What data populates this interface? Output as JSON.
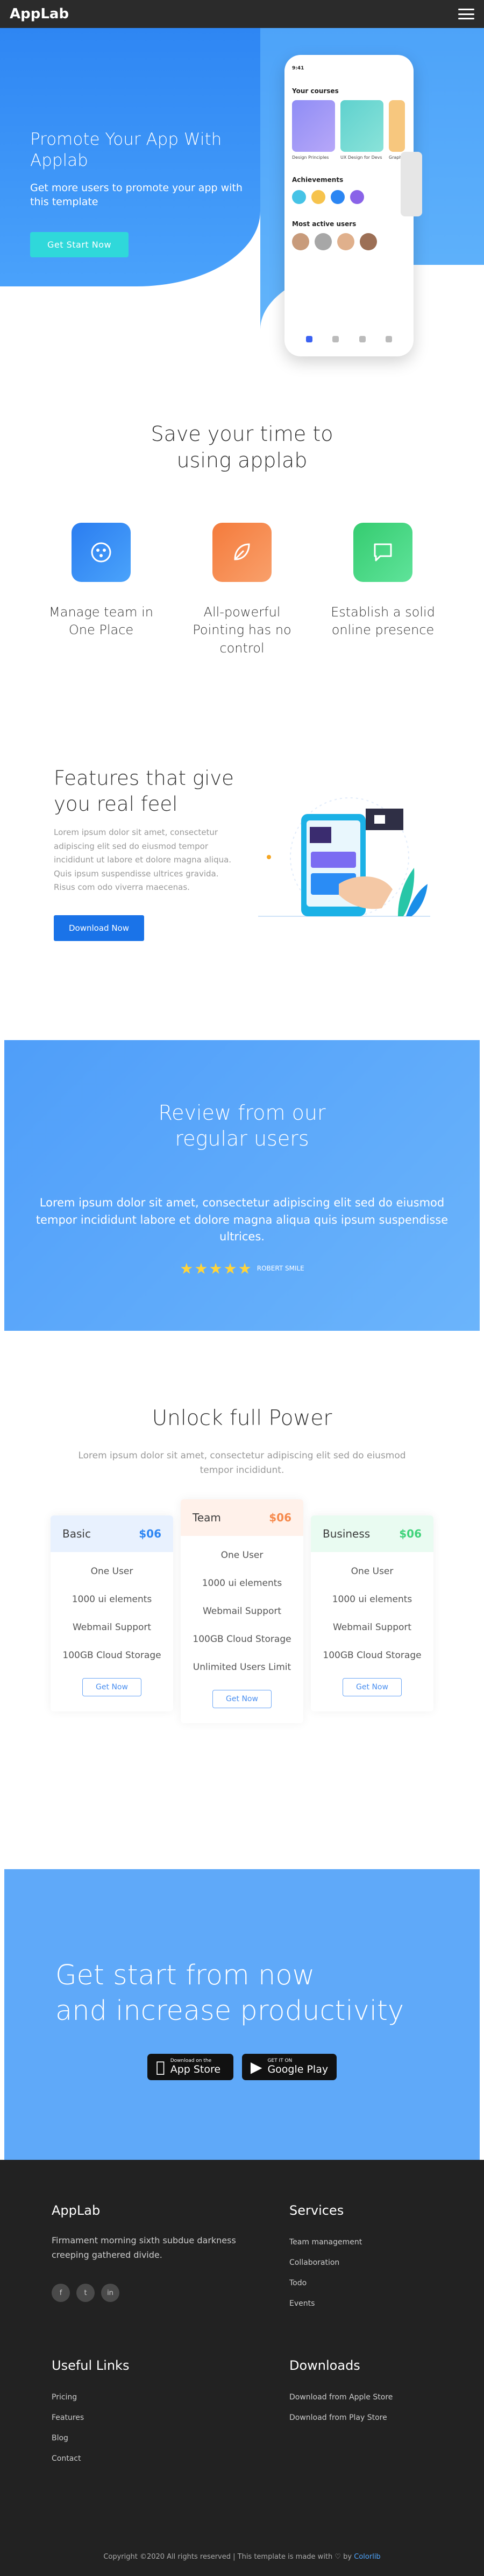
{
  "header": {
    "brand": "AppLab"
  },
  "hero": {
    "title": "Promote Your App With Applab",
    "subtitle": "Get more users to promote your app with this template",
    "button": "Get Start Now"
  },
  "phone": {
    "time": "9:41",
    "courses_title": "Your courses",
    "courses": [
      {
        "label": "Design Principles"
      },
      {
        "label": "UX Design for Devs"
      },
      {
        "label": "Graphic"
      }
    ],
    "achievements_title": "Achievements",
    "active_title": "Most active users"
  },
  "save": {
    "title_line1": "Save your time to",
    "title_line2": "using applab",
    "cards": [
      {
        "label": "Manage team in One Place",
        "icon": "team-icon",
        "color": "#2e86f3"
      },
      {
        "label": "All-powerful Pointing has no control",
        "icon": "leaf-icon",
        "color": "#f68a4d"
      },
      {
        "label": "Establish a solid online presence",
        "icon": "chat-icon",
        "color": "#3fd37a"
      }
    ]
  },
  "features": {
    "title": "Features that give you real feel",
    "text": "Lorem ipsum dolor sit amet, consectetur adipiscing elit sed do eiusmod tempor incididunt ut labore et dolore magna aliqua. Quis ipsum suspendisse ultrices gravida. Risus com odo viverra maecenas.",
    "button": "Download Now"
  },
  "review": {
    "title_line1": "Review from our",
    "title_line2": "regular users",
    "text": "Lorem ipsum dolor sit amet, consectetur adipiscing elit sed do eiusmod tempor incididunt labore et dolore magna aliqua quis ipsum suspendisse ultrices.",
    "stars": "★★★★★",
    "name": "ROBERT SMILE"
  },
  "pricing": {
    "title": "Unlock full Power",
    "subtitle": "Lorem ipsum dolor sit amet, consectetur adipiscing elit sed do eiusmod tempor incididunt.",
    "plans": [
      {
        "name": "Basic",
        "price": "$06",
        "features": [
          "One User",
          "1000 ui elements",
          "Webmail Support",
          "100GB Cloud Storage"
        ],
        "button": "Get Now",
        "head_bg": "#e8f1fe",
        "price_color": "#2e86f3"
      },
      {
        "name": "Team",
        "price": "$06",
        "features": [
          "One User",
          "1000 ui elements",
          "Webmail Support",
          "100GB Cloud Storage",
          "Unlimited Users Limit"
        ],
        "button": "Get Now",
        "head_bg": "#fff1ea",
        "price_color": "#f68a4d"
      },
      {
        "name": "Business",
        "price": "$06",
        "features": [
          "One User",
          "1000 ui elements",
          "Webmail Support",
          "100GB Cloud Storage"
        ],
        "button": "Get Now",
        "head_bg": "#e9fbf1",
        "price_color": "#3fd37a"
      }
    ]
  },
  "cta": {
    "title_line1": "Get start from now",
    "title_line2": "and increase productivity",
    "app_store_small": "Download on the",
    "app_store": "App Store",
    "google_play_small": "GET IT ON",
    "google_play": "Google Play"
  },
  "footer": {
    "brand": "AppLab",
    "about": "Firmament morning sixth subdue darkness creeping gathered divide.",
    "social": [
      "f",
      "t",
      "in"
    ],
    "services_title": "Services",
    "services": [
      "Team management",
      "Collaboration",
      "Todo",
      "Events"
    ],
    "links_title": "Useful Links",
    "links": [
      "Pricing",
      "Features",
      "Blog",
      "Contact"
    ],
    "downloads_title": "Downloads",
    "downloads": [
      "Download from Apple Store",
      "Download from Play Store"
    ],
    "copyright_pre": "Copyright ©2020 All rights reserved | This template is made with ♡ by ",
    "copyright_link": "Colorlib"
  }
}
